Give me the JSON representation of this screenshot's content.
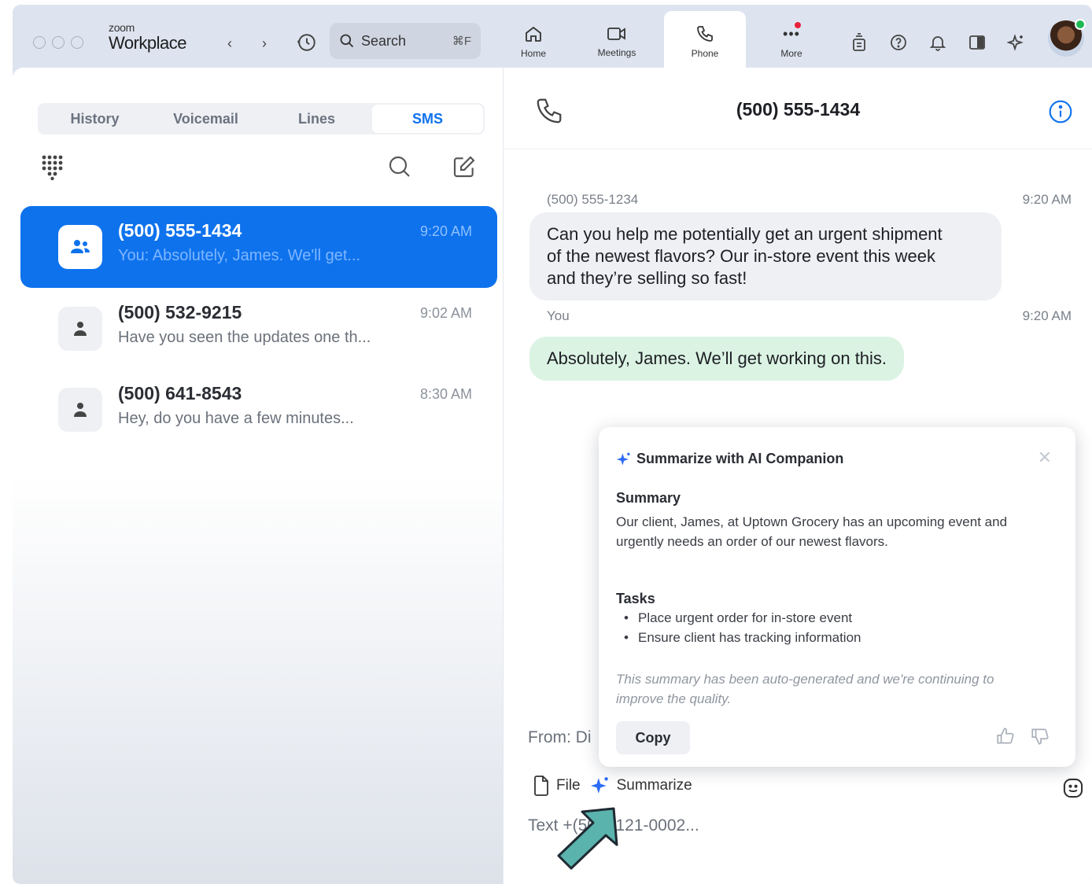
{
  "app": {
    "brand_small": "zoom",
    "brand_large": "Workplace",
    "search_placeholder": "Search",
    "search_shortcut": "⌘F",
    "nav": [
      {
        "label": "Home",
        "icon": "home-icon"
      },
      {
        "label": "Meetings",
        "icon": "video-icon"
      },
      {
        "label": "Phone",
        "icon": "phone-icon"
      },
      {
        "label": "More",
        "icon": "more-icon"
      }
    ]
  },
  "left": {
    "tabs": [
      "History",
      "Voicemail",
      "Lines",
      "SMS"
    ],
    "active_tab": "SMS",
    "conversations": [
      {
        "name": "(500) 555-1434",
        "time": "9:20 AM",
        "preview": "You: Absolutely, James. We'll get...",
        "type": "group",
        "active": true
      },
      {
        "name": "(500) 532-9215",
        "time": "9:02 AM",
        "preview": "Have you seen the updates one th...",
        "type": "single",
        "active": false
      },
      {
        "name": "(500) 641-8543",
        "time": "8:30 AM",
        "preview": "Hey, do you have a few minutes...",
        "type": "single",
        "active": false
      }
    ]
  },
  "chat": {
    "title": "(500) 555-1434",
    "messages": [
      {
        "sender": "(500) 555-1234",
        "time": "9:20 AM",
        "lines": [
          "Can you help me potentially get an urgent shipment",
          "of the newest flavors? Our in-store event this week",
          "and they’re selling so fast!"
        ]
      },
      {
        "sender": "You",
        "time": "9:20 AM",
        "lines": [
          "Absolutely, James. We’ll get working on this."
        ]
      }
    ],
    "from_label": "From: Di",
    "file_label": "File",
    "summarize_label": "Summarize",
    "input_text": "Text +(501) 121-0002..."
  },
  "ai_panel": {
    "title": "Summarize with AI Companion",
    "summary_heading": "Summary",
    "summary_text": "Our client, James, at Uptown Grocery has an upcoming event and urgently needs an order of our newest flavors.",
    "tasks_heading": "Tasks",
    "tasks": [
      "Place urgent order for in-store event",
      "Ensure client has tracking information"
    ],
    "note": "This summary has been auto-generated and we're continuing to improve the quality.",
    "copy_label": "Copy"
  },
  "colors": {
    "accent": "#0e72ed",
    "ai_star": "#2d6cf6",
    "outgoing_bubble": "#dbf3e3",
    "incoming_bubble": "#eef0f4",
    "arrow": "#5ab3ad",
    "online": "#1db954"
  }
}
